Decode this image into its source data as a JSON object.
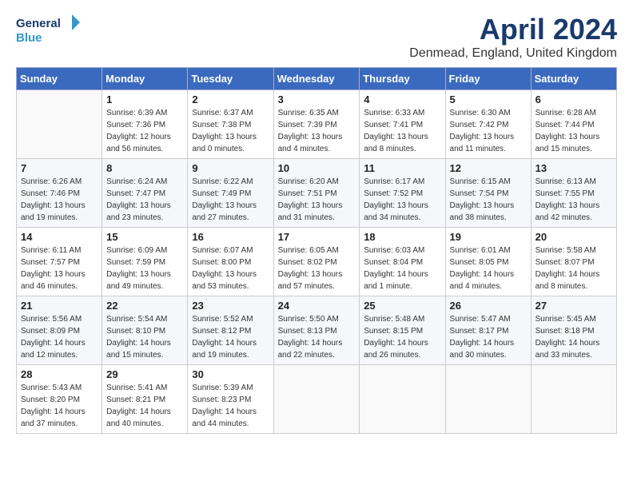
{
  "header": {
    "logo_line1": "General",
    "logo_line2": "Blue",
    "month_title": "April 2024",
    "location": "Denmead, England, United Kingdom"
  },
  "days_of_week": [
    "Sunday",
    "Monday",
    "Tuesday",
    "Wednesday",
    "Thursday",
    "Friday",
    "Saturday"
  ],
  "weeks": [
    [
      {
        "day": "",
        "sunrise": "",
        "sunset": "",
        "daylight": ""
      },
      {
        "day": "1",
        "sunrise": "Sunrise: 6:39 AM",
        "sunset": "Sunset: 7:36 PM",
        "daylight": "Daylight: 12 hours and 56 minutes."
      },
      {
        "day": "2",
        "sunrise": "Sunrise: 6:37 AM",
        "sunset": "Sunset: 7:38 PM",
        "daylight": "Daylight: 13 hours and 0 minutes."
      },
      {
        "day": "3",
        "sunrise": "Sunrise: 6:35 AM",
        "sunset": "Sunset: 7:39 PM",
        "daylight": "Daylight: 13 hours and 4 minutes."
      },
      {
        "day": "4",
        "sunrise": "Sunrise: 6:33 AM",
        "sunset": "Sunset: 7:41 PM",
        "daylight": "Daylight: 13 hours and 8 minutes."
      },
      {
        "day": "5",
        "sunrise": "Sunrise: 6:30 AM",
        "sunset": "Sunset: 7:42 PM",
        "daylight": "Daylight: 13 hours and 11 minutes."
      },
      {
        "day": "6",
        "sunrise": "Sunrise: 6:28 AM",
        "sunset": "Sunset: 7:44 PM",
        "daylight": "Daylight: 13 hours and 15 minutes."
      }
    ],
    [
      {
        "day": "7",
        "sunrise": "Sunrise: 6:26 AM",
        "sunset": "Sunset: 7:46 PM",
        "daylight": "Daylight: 13 hours and 19 minutes."
      },
      {
        "day": "8",
        "sunrise": "Sunrise: 6:24 AM",
        "sunset": "Sunset: 7:47 PM",
        "daylight": "Daylight: 13 hours and 23 minutes."
      },
      {
        "day": "9",
        "sunrise": "Sunrise: 6:22 AM",
        "sunset": "Sunset: 7:49 PM",
        "daylight": "Daylight: 13 hours and 27 minutes."
      },
      {
        "day": "10",
        "sunrise": "Sunrise: 6:20 AM",
        "sunset": "Sunset: 7:51 PM",
        "daylight": "Daylight: 13 hours and 31 minutes."
      },
      {
        "day": "11",
        "sunrise": "Sunrise: 6:17 AM",
        "sunset": "Sunset: 7:52 PM",
        "daylight": "Daylight: 13 hours and 34 minutes."
      },
      {
        "day": "12",
        "sunrise": "Sunrise: 6:15 AM",
        "sunset": "Sunset: 7:54 PM",
        "daylight": "Daylight: 13 hours and 38 minutes."
      },
      {
        "day": "13",
        "sunrise": "Sunrise: 6:13 AM",
        "sunset": "Sunset: 7:55 PM",
        "daylight": "Daylight: 13 hours and 42 minutes."
      }
    ],
    [
      {
        "day": "14",
        "sunrise": "Sunrise: 6:11 AM",
        "sunset": "Sunset: 7:57 PM",
        "daylight": "Daylight: 13 hours and 46 minutes."
      },
      {
        "day": "15",
        "sunrise": "Sunrise: 6:09 AM",
        "sunset": "Sunset: 7:59 PM",
        "daylight": "Daylight: 13 hours and 49 minutes."
      },
      {
        "day": "16",
        "sunrise": "Sunrise: 6:07 AM",
        "sunset": "Sunset: 8:00 PM",
        "daylight": "Daylight: 13 hours and 53 minutes."
      },
      {
        "day": "17",
        "sunrise": "Sunrise: 6:05 AM",
        "sunset": "Sunset: 8:02 PM",
        "daylight": "Daylight: 13 hours and 57 minutes."
      },
      {
        "day": "18",
        "sunrise": "Sunrise: 6:03 AM",
        "sunset": "Sunset: 8:04 PM",
        "daylight": "Daylight: 14 hours and 1 minute."
      },
      {
        "day": "19",
        "sunrise": "Sunrise: 6:01 AM",
        "sunset": "Sunset: 8:05 PM",
        "daylight": "Daylight: 14 hours and 4 minutes."
      },
      {
        "day": "20",
        "sunrise": "Sunrise: 5:58 AM",
        "sunset": "Sunset: 8:07 PM",
        "daylight": "Daylight: 14 hours and 8 minutes."
      }
    ],
    [
      {
        "day": "21",
        "sunrise": "Sunrise: 5:56 AM",
        "sunset": "Sunset: 8:09 PM",
        "daylight": "Daylight: 14 hours and 12 minutes."
      },
      {
        "day": "22",
        "sunrise": "Sunrise: 5:54 AM",
        "sunset": "Sunset: 8:10 PM",
        "daylight": "Daylight: 14 hours and 15 minutes."
      },
      {
        "day": "23",
        "sunrise": "Sunrise: 5:52 AM",
        "sunset": "Sunset: 8:12 PM",
        "daylight": "Daylight: 14 hours and 19 minutes."
      },
      {
        "day": "24",
        "sunrise": "Sunrise: 5:50 AM",
        "sunset": "Sunset: 8:13 PM",
        "daylight": "Daylight: 14 hours and 22 minutes."
      },
      {
        "day": "25",
        "sunrise": "Sunrise: 5:48 AM",
        "sunset": "Sunset: 8:15 PM",
        "daylight": "Daylight: 14 hours and 26 minutes."
      },
      {
        "day": "26",
        "sunrise": "Sunrise: 5:47 AM",
        "sunset": "Sunset: 8:17 PM",
        "daylight": "Daylight: 14 hours and 30 minutes."
      },
      {
        "day": "27",
        "sunrise": "Sunrise: 5:45 AM",
        "sunset": "Sunset: 8:18 PM",
        "daylight": "Daylight: 14 hours and 33 minutes."
      }
    ],
    [
      {
        "day": "28",
        "sunrise": "Sunrise: 5:43 AM",
        "sunset": "Sunset: 8:20 PM",
        "daylight": "Daylight: 14 hours and 37 minutes."
      },
      {
        "day": "29",
        "sunrise": "Sunrise: 5:41 AM",
        "sunset": "Sunset: 8:21 PM",
        "daylight": "Daylight: 14 hours and 40 minutes."
      },
      {
        "day": "30",
        "sunrise": "Sunrise: 5:39 AM",
        "sunset": "Sunset: 8:23 PM",
        "daylight": "Daylight: 14 hours and 44 minutes."
      },
      {
        "day": "",
        "sunrise": "",
        "sunset": "",
        "daylight": ""
      },
      {
        "day": "",
        "sunrise": "",
        "sunset": "",
        "daylight": ""
      },
      {
        "day": "",
        "sunrise": "",
        "sunset": "",
        "daylight": ""
      },
      {
        "day": "",
        "sunrise": "",
        "sunset": "",
        "daylight": ""
      }
    ]
  ]
}
